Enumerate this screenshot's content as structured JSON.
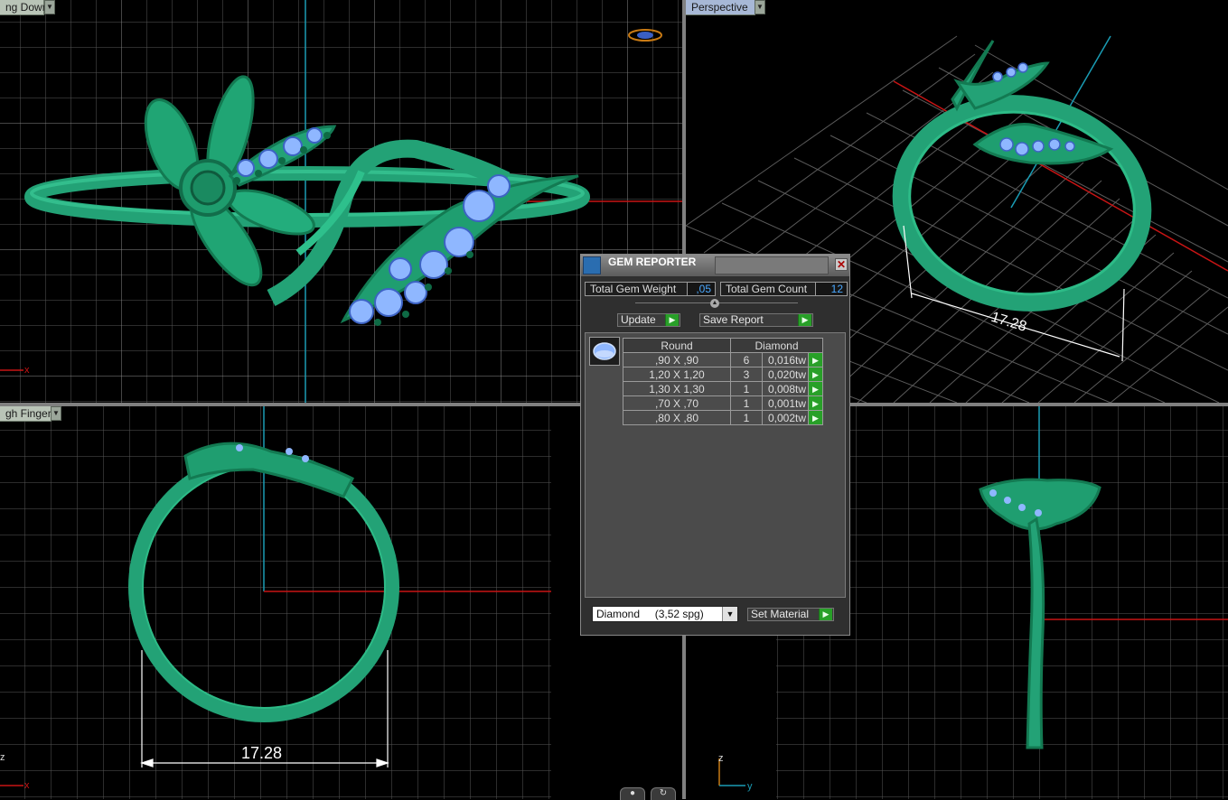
{
  "viewports": {
    "top_left_label": "ng Down",
    "top_right_label": "Perspective",
    "bottom_left_label": "gh Finger",
    "dimension_top_right": "17.28",
    "dimension_bottom_left": "17.28",
    "axis_x": "x",
    "axis_y": "y",
    "axis_z": "z"
  },
  "colors": {
    "ring": "#1f9e72",
    "ring_light": "#2fc18e",
    "gem": "#8fb7ff",
    "grid": "#5a5a5a",
    "axis_red": "#c81414",
    "axis_cyan": "#1a9cb4"
  },
  "gem_reporter": {
    "title": "GEM REPORTER",
    "close_glyph": "✕",
    "total_weight_label": "Total Gem Weight",
    "total_weight_value": ",05",
    "total_count_label": "Total Gem Count",
    "total_count_value": "12",
    "update_label": "Update",
    "save_report_label": "Save Report",
    "go_glyph": "▶",
    "table": {
      "headers": [
        "Round",
        "Diamond"
      ],
      "rows": [
        {
          "size": ",90 X ,90",
          "count": "6",
          "weight": "0,016tw"
        },
        {
          "size": "1,20 X 1,20",
          "count": "3",
          "weight": "0,020tw"
        },
        {
          "size": "1,30 X 1,30",
          "count": "1",
          "weight": "0,008tw"
        },
        {
          "size": ",70 X ,70",
          "count": "1",
          "weight": "0,001tw"
        },
        {
          "size": ",80 X ,80",
          "count": "1",
          "weight": "0,002tw"
        }
      ]
    },
    "material_select": "Diamond     (3,52 spg)",
    "set_material_label": "Set Material"
  }
}
